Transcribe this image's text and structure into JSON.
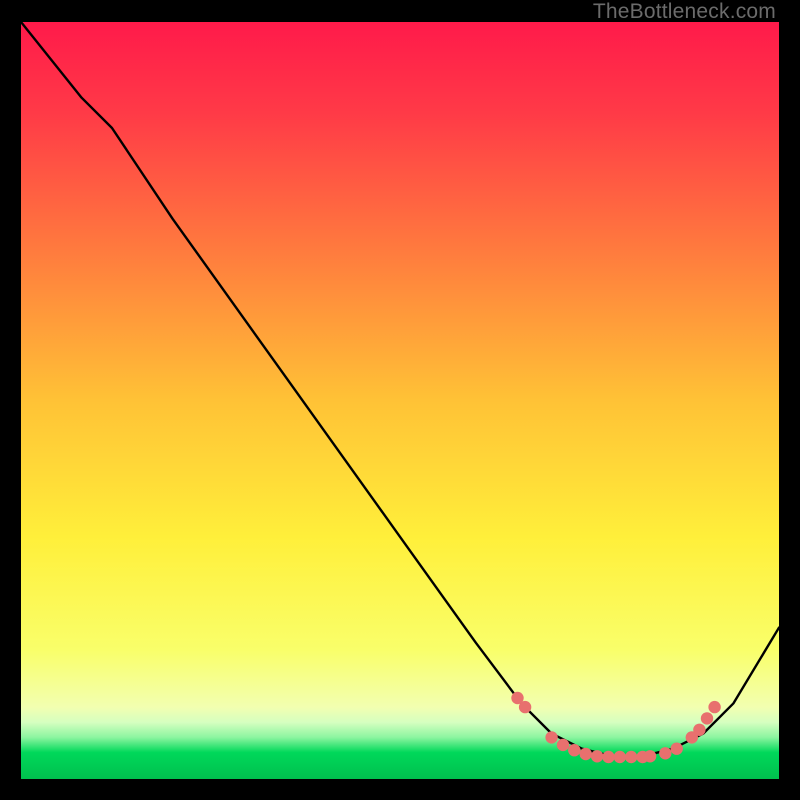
{
  "watermark": "TheBottleneck.com",
  "chart_data": {
    "type": "line",
    "title": "",
    "xlabel": "",
    "ylabel": "",
    "xlim": [
      0,
      100
    ],
    "ylim": [
      0,
      100
    ],
    "background_gradient": {
      "top": "#ff1a4a",
      "upper_mid": "#ff8a3d",
      "mid": "#ffe234",
      "lower_mid": "#f6ff66",
      "green_band": "#00d85a",
      "bottom_band_y_range": [
        93,
        100
      ]
    },
    "series": [
      {
        "name": "bottleneck-curve",
        "x": [
          0,
          8,
          12,
          20,
          30,
          40,
          50,
          60,
          66,
          70,
          74,
          78,
          82,
          86,
          90,
          94,
          100
        ],
        "y": [
          0,
          10,
          14,
          26,
          40,
          54,
          68,
          82,
          90,
          94,
          96,
          97,
          97,
          96,
          94,
          90,
          80
        ]
      }
    ],
    "marker_points": {
      "name": "highlight-dots",
      "color": "#e8706e",
      "x": [
        65.5,
        66.5,
        70,
        71.5,
        73,
        74.5,
        76,
        77.5,
        79,
        80.5,
        82,
        83,
        85,
        86.5,
        88.5,
        89.5,
        90.5,
        91.5
      ],
      "y": [
        89.3,
        90.5,
        94.5,
        95.5,
        96.2,
        96.7,
        97,
        97.1,
        97.1,
        97.1,
        97.1,
        97,
        96.6,
        96,
        94.5,
        93.5,
        92,
        90.5
      ]
    }
  }
}
